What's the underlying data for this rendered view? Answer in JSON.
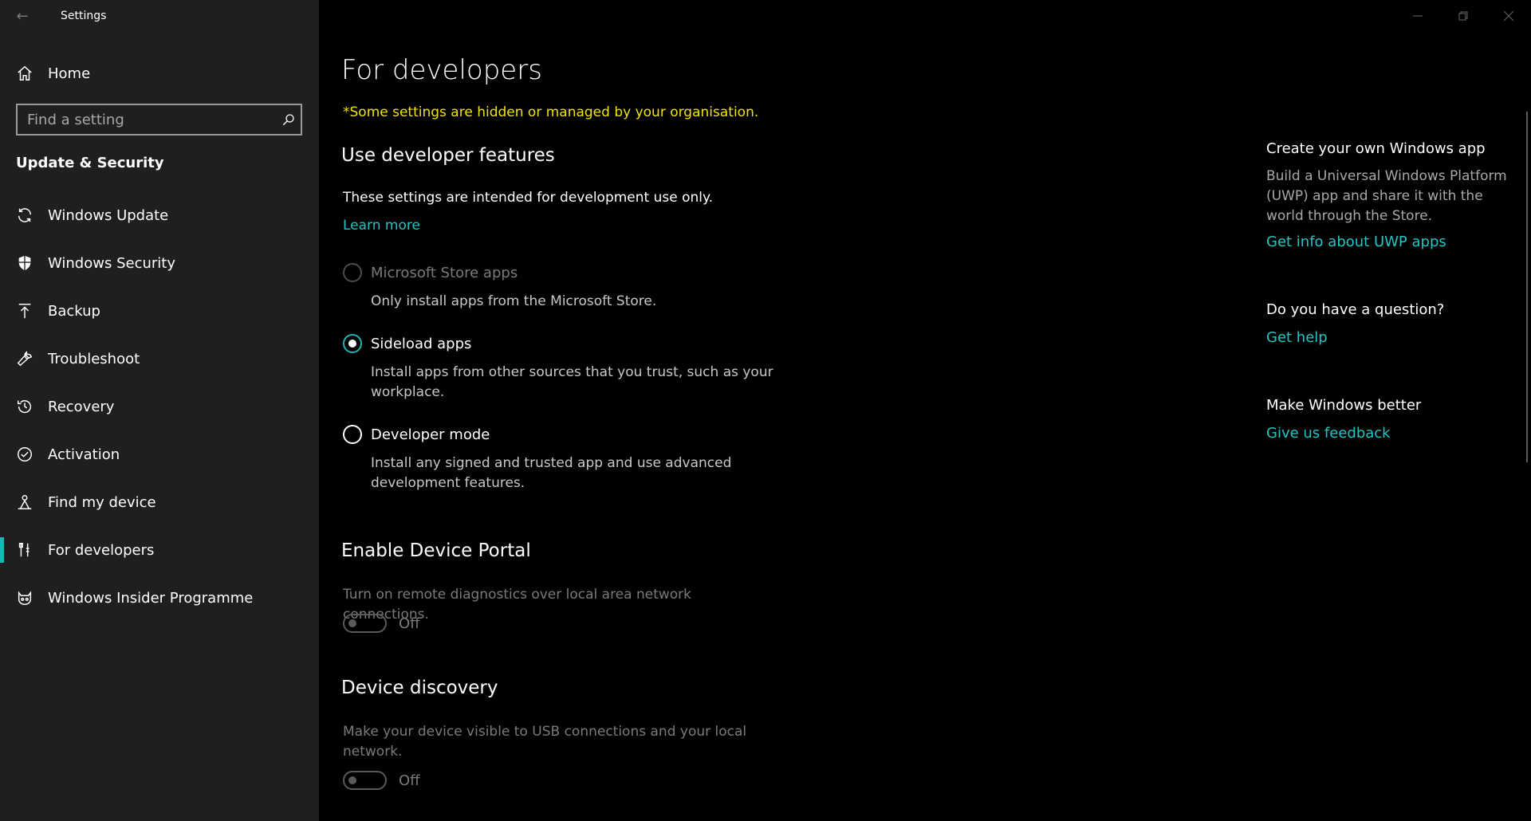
{
  "window": {
    "title": "Settings"
  },
  "sidebar": {
    "home_label": "Home",
    "search_placeholder": "Find a setting",
    "section_label": "Update & Security",
    "items": [
      {
        "label": "Windows Update",
        "icon": "refresh-icon"
      },
      {
        "label": "Windows Security",
        "icon": "shield-icon"
      },
      {
        "label": "Backup",
        "icon": "upload-icon"
      },
      {
        "label": "Troubleshoot",
        "icon": "wrench-icon"
      },
      {
        "label": "Recovery",
        "icon": "history-icon"
      },
      {
        "label": "Activation",
        "icon": "check-circle-icon"
      },
      {
        "label": "Find my device",
        "icon": "person-location-icon"
      },
      {
        "label": "For developers",
        "icon": "developer-tools-icon",
        "selected": true
      },
      {
        "label": "Windows Insider Programme",
        "icon": "insider-cat-icon"
      }
    ]
  },
  "main": {
    "title": "For developers",
    "managed_note": "*Some settings are hidden or managed by your organisation.",
    "dev_features": {
      "heading": "Use developer features",
      "intro": "These settings are intended for development use only.",
      "learn_more": "Learn more",
      "options": [
        {
          "label": "Microsoft Store apps",
          "description": "Only install apps from the Microsoft Store.",
          "state": "disabled"
        },
        {
          "label": "Sideload apps",
          "description": "Install apps from other sources that you trust, such as your workplace.",
          "state": "checked"
        },
        {
          "label": "Developer mode",
          "description": "Install any signed and trusted app and use advanced development features.",
          "state": "unchecked"
        }
      ]
    },
    "device_portal": {
      "heading": "Enable Device Portal",
      "description": "Turn on remote diagnostics over local area network connections.",
      "toggle_state": "Off"
    },
    "device_discovery": {
      "heading": "Device discovery",
      "description": "Make your device visible to USB connections and your local network.",
      "toggle_state": "Off"
    }
  },
  "right_panel": {
    "uwp": {
      "heading": "Create your own Windows app",
      "text": "Build a Universal Windows Platform (UWP) app and share it with the world through the Store.",
      "link": "Get info about UWP apps"
    },
    "question": {
      "heading": "Do you have a question?",
      "link": "Get help"
    },
    "feedback": {
      "heading": "Make Windows better",
      "link": "Give us feedback"
    }
  },
  "colors": {
    "accent": "#1fb4b4",
    "link": "#1fc6c6",
    "warning": "#f0e40a",
    "sidebar_bg": "#1f1f1f",
    "main_bg": "#000000"
  }
}
